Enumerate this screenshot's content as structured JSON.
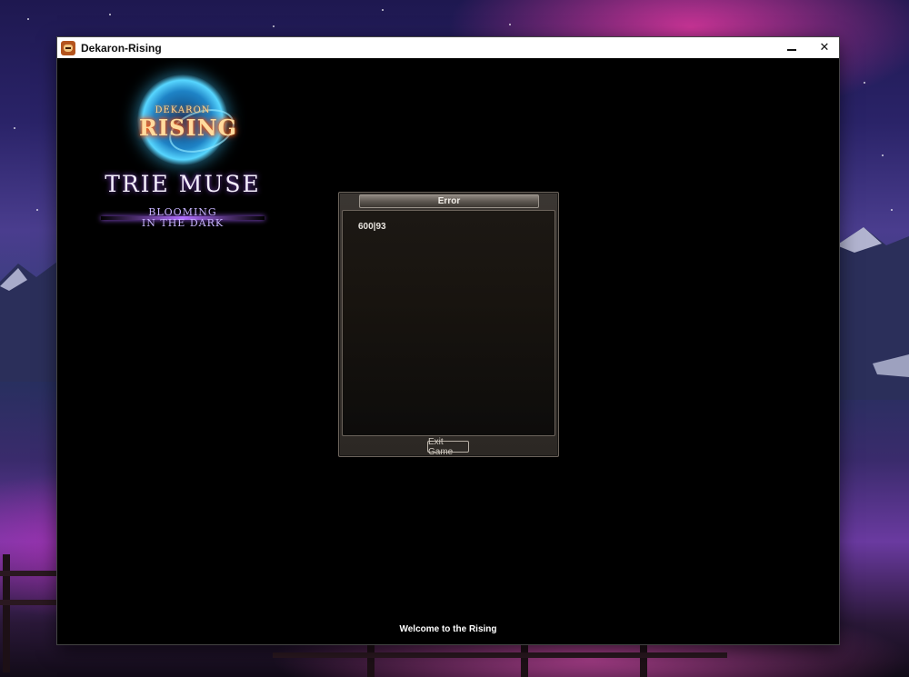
{
  "window": {
    "title": "Dekaron-Rising",
    "close_glyph": "✕"
  },
  "logo": {
    "dekaron": "DEKARON",
    "rising": "RISING",
    "title": "TRIE MUSE",
    "subtitle_line1": "BLOOMING",
    "subtitle_line2": "IN THE DARK"
  },
  "error_dialog": {
    "title": "Error",
    "message": "600|93",
    "exit_label": "Exit Game"
  },
  "footer": {
    "welcome": "Welcome to the Rising"
  },
  "colors": {
    "dialog_border": "#6c645c",
    "accent_purple": "#b06cff"
  }
}
